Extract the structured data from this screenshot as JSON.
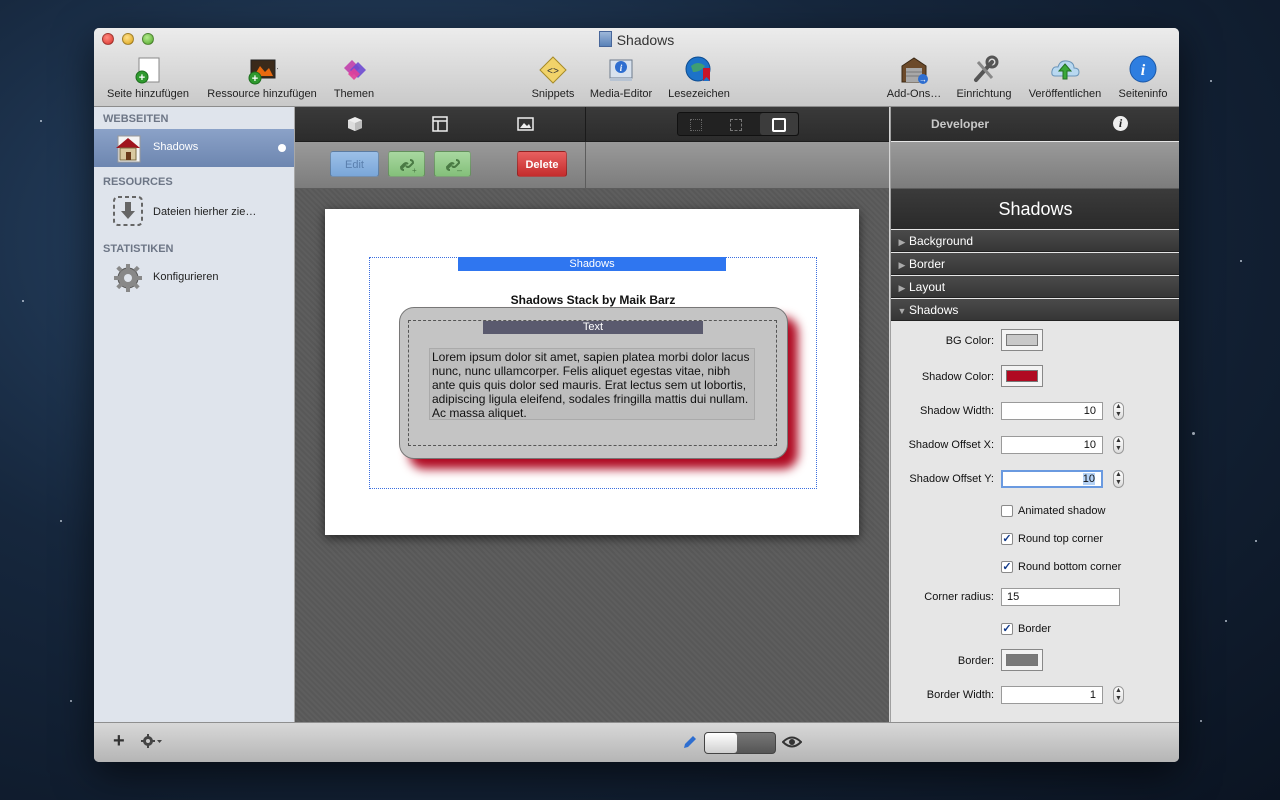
{
  "window": {
    "title": "Shadows"
  },
  "toolbar": {
    "left": [
      {
        "label": "Seite hinzufügen",
        "icon": "add-page-icon"
      },
      {
        "label": "Ressource hinzufügen",
        "icon": "add-resource-icon"
      },
      {
        "label": "Themen",
        "icon": "themes-icon"
      }
    ],
    "center": [
      {
        "label": "Snippets",
        "icon": "snippets-icon"
      },
      {
        "label": "Media-Editor",
        "icon": "media-editor-icon"
      },
      {
        "label": "Lesezeichen",
        "icon": "bookmarks-icon"
      }
    ],
    "right": [
      {
        "label": "Add-Ons…",
        "icon": "addons-icon"
      },
      {
        "label": "Einrichtung",
        "icon": "setup-icon"
      },
      {
        "label": "Veröffentlichen",
        "icon": "publish-icon"
      },
      {
        "label": "Seiteninfo",
        "icon": "page-info-icon"
      }
    ]
  },
  "sidebar": {
    "sections": [
      {
        "title": "WEBSEITEN",
        "items": [
          {
            "label": "Shadows",
            "icon": "home-page-icon",
            "selected": true
          }
        ]
      },
      {
        "title": "RESOURCES",
        "items": [
          {
            "label": "Dateien hierher zie…",
            "icon": "drop-files-icon"
          }
        ]
      },
      {
        "title": "STATISTIKEN",
        "items": [
          {
            "label": "Konfigurieren",
            "icon": "gear-icon"
          }
        ]
      }
    ]
  },
  "editor": {
    "actions": {
      "edit": "Edit",
      "delete": "Delete"
    },
    "stack": {
      "tab": "Shadows",
      "title": "Shadows Stack by Maik Barz",
      "text_tab": "Text",
      "body": "Lorem ipsum dolor sit amet, sapien platea morbi dolor lacus nunc, nunc ullamcorper. Felis aliquet egestas vitae, nibh ante quis quis dolor sed mauris. Erat lectus sem ut lobortis, adipiscing ligula eleifend, sodales fringilla mattis dui nullam. Ac massa aliquet."
    }
  },
  "inspector": {
    "tab_label": "Developer",
    "title": "Shadows",
    "sections": [
      "Background",
      "Border",
      "Layout",
      "Shadows"
    ],
    "fields": {
      "bg_color_label": "BG Color:",
      "bg_color": "#c8c8c8",
      "shadow_color_label": "Shadow Color:",
      "shadow_color": "#b00a22",
      "shadow_width_label": "Shadow Width:",
      "shadow_width": "10",
      "shadow_offset_x_label": "Shadow Offset X:",
      "shadow_offset_x": "10",
      "shadow_offset_y_label": "Shadow Offset Y:",
      "shadow_offset_y": "10",
      "animated_shadow_label": "Animated shadow",
      "animated_shadow": false,
      "round_top_label": "Round top corner",
      "round_top": true,
      "round_bottom_label": "Round bottom corner",
      "round_bottom": true,
      "corner_radius_label": "Corner radius:",
      "corner_radius": "15",
      "border_check_label": "Border",
      "border_check": true,
      "border_color_label": "Border:",
      "border_color": "#7a7a7a",
      "border_width_label": "Border Width:",
      "border_width": "1"
    }
  }
}
